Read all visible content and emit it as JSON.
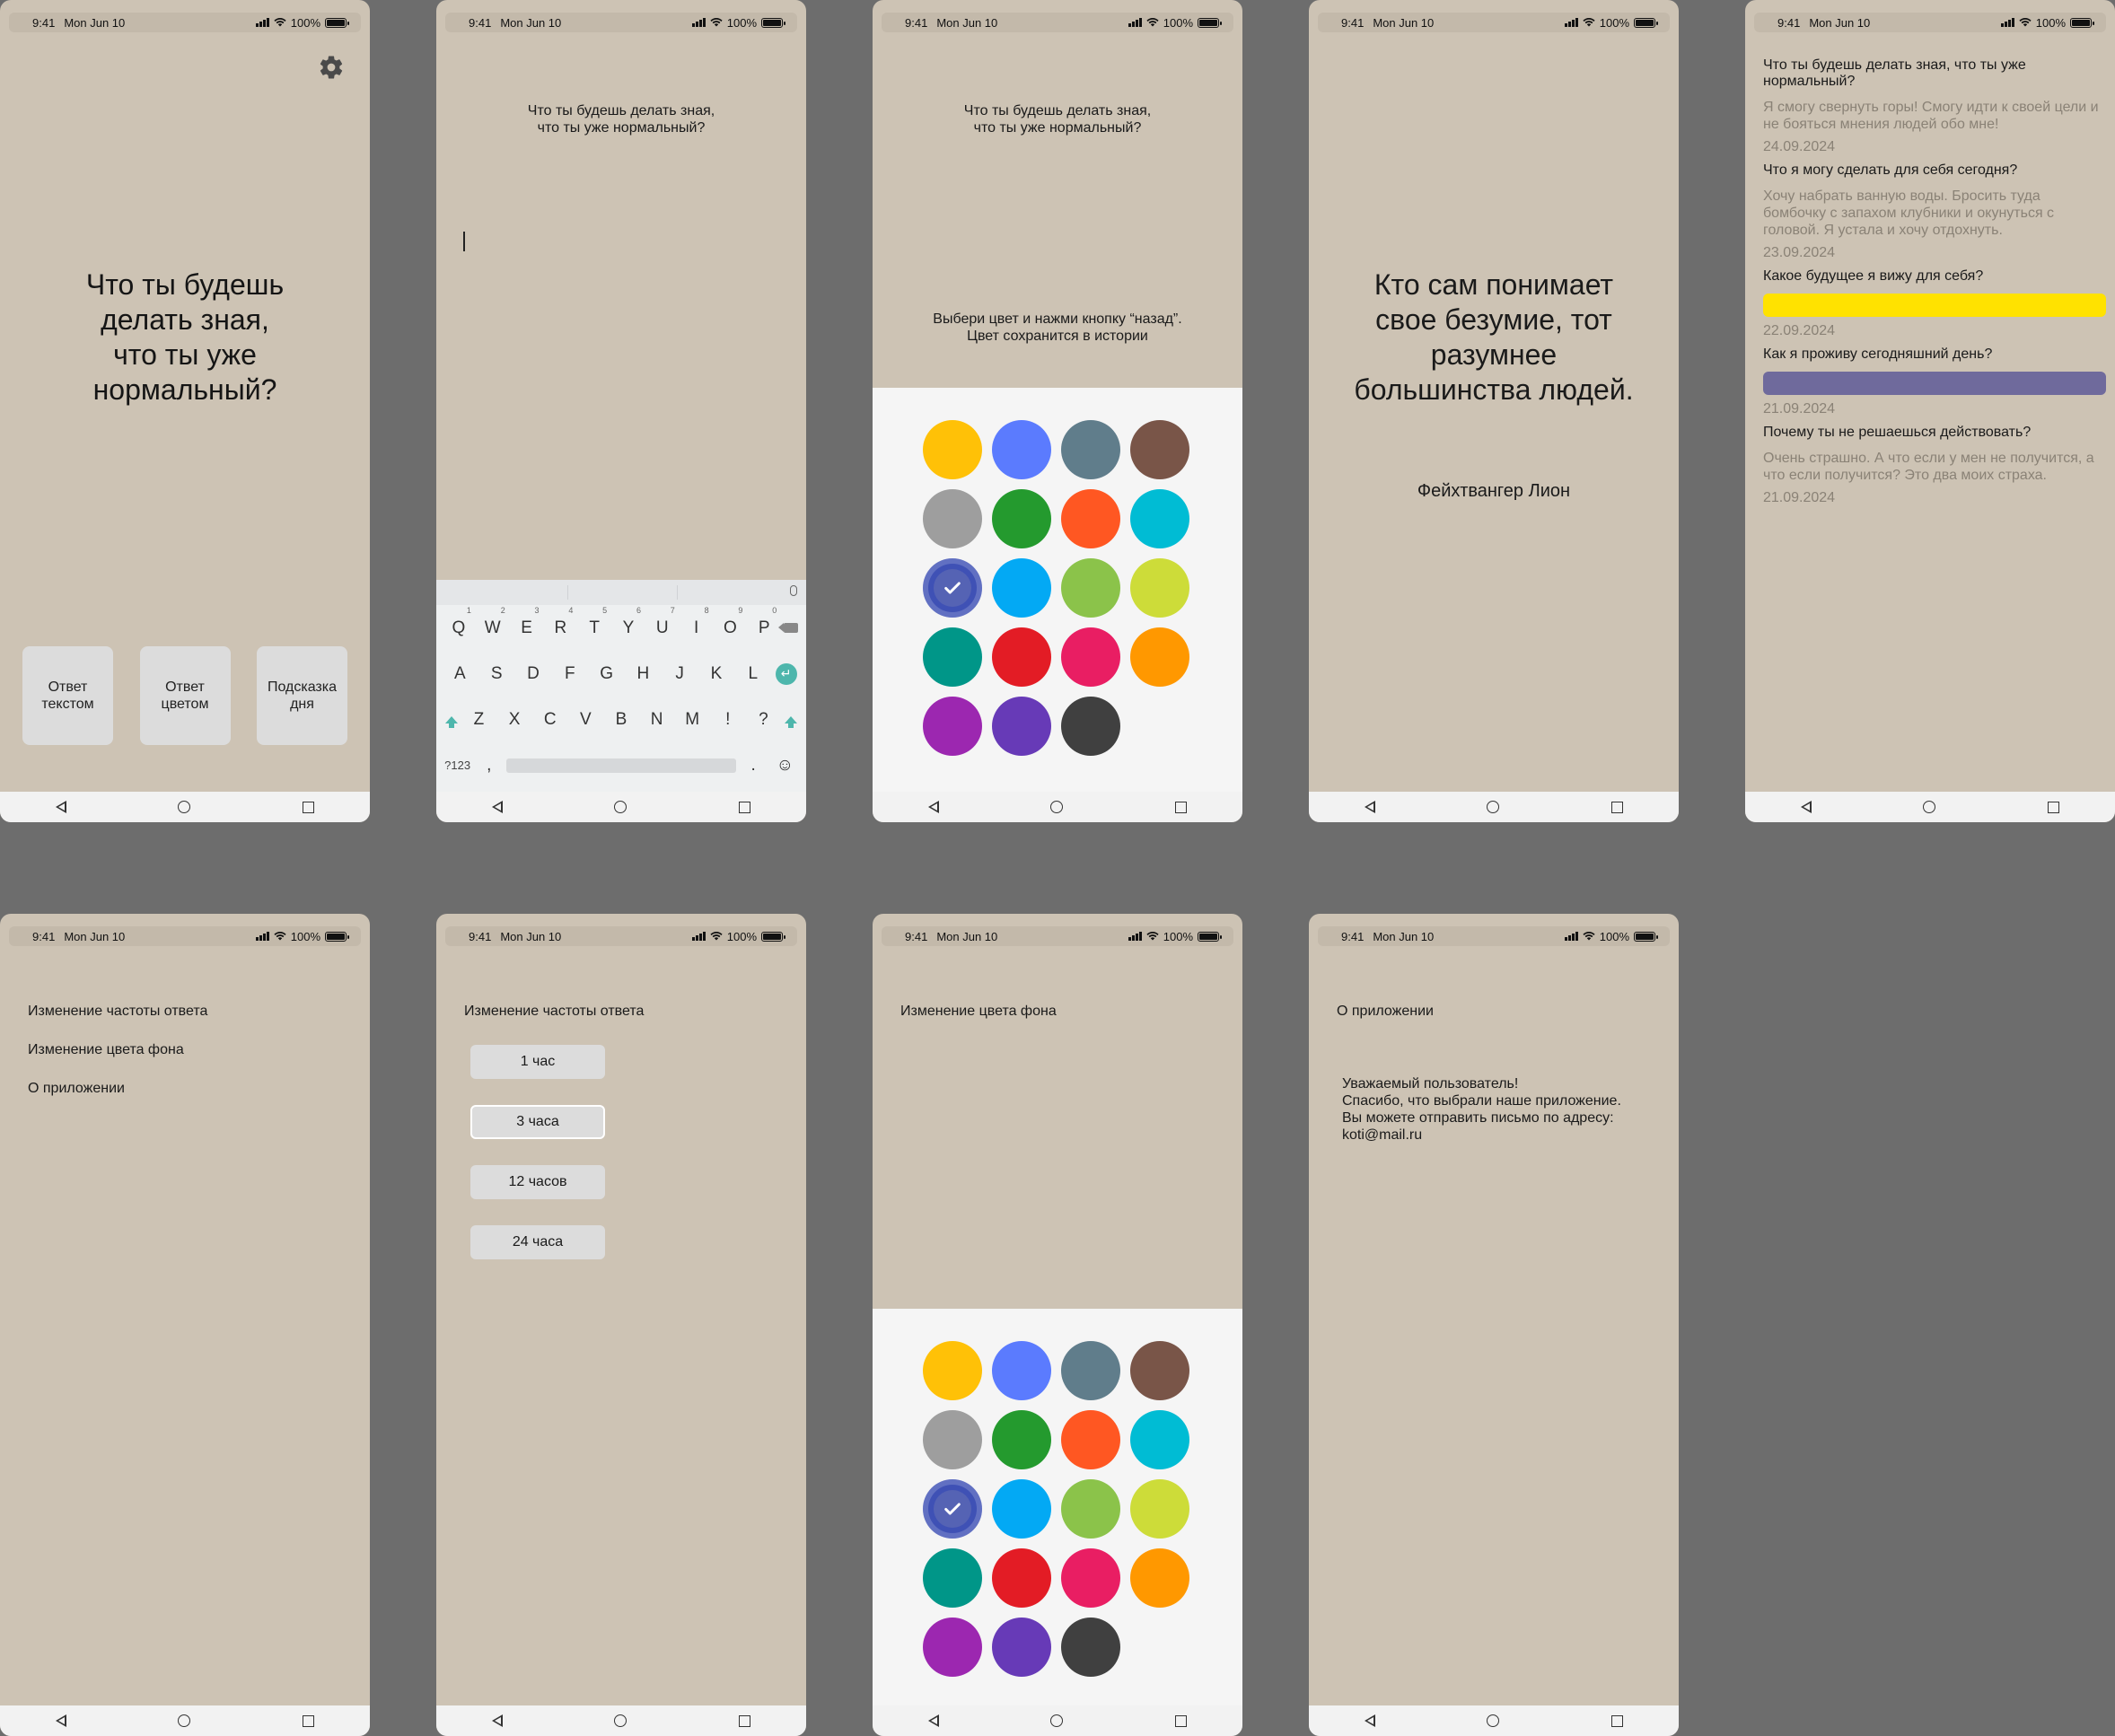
{
  "status": {
    "time": "9:41",
    "date": "Mon Jun 10",
    "battery": "100%"
  },
  "home": {
    "question": "Что ты будешь делать зная, что ты уже нормальный?",
    "question_lines": [
      "Что ты будешь",
      "делать зная,",
      "что ты уже",
      "нормальный?"
    ],
    "buttons": [
      {
        "line1": "Ответ",
        "line2": "текстом"
      },
      {
        "line1": "Ответ",
        "line2": "цветом"
      },
      {
        "line1": "Подсказка",
        "line2": "дня"
      }
    ]
  },
  "text_answer": {
    "question_lines": [
      "Что ты будешь делать зная,",
      "что ты уже нормальный?"
    ]
  },
  "keyboard": {
    "row1": [
      {
        "k": "Q",
        "n": "1"
      },
      {
        "k": "W",
        "n": "2"
      },
      {
        "k": "E",
        "n": "3"
      },
      {
        "k": "R",
        "n": "4"
      },
      {
        "k": "T",
        "n": "5"
      },
      {
        "k": "Y",
        "n": "6"
      },
      {
        "k": "U",
        "n": "7"
      },
      {
        "k": "I",
        "n": "8"
      },
      {
        "k": "O",
        "n": "9"
      },
      {
        "k": "P",
        "n": "0"
      }
    ],
    "row2": [
      "A",
      "S",
      "D",
      "F",
      "G",
      "H",
      "J",
      "K",
      "L"
    ],
    "row3": [
      "Z",
      "X",
      "C",
      "V",
      "B",
      "N",
      "M",
      "!",
      "?"
    ],
    "symbols_key": "?123",
    "comma": ",",
    "period": ".",
    "emoji": "☺"
  },
  "color_answer": {
    "question_lines": [
      "Что ты будешь делать зная,",
      "что ты уже нормальный?"
    ],
    "hint_lines": [
      "Выбери цвет и нажми кнопку “назад”.",
      "Цвет сохранится в истории"
    ]
  },
  "palette_colors": [
    "#ffc107",
    "#5b7bfe",
    "#607d8b",
    "#795548",
    "#9e9e9e",
    "#249a2e",
    "#ff5722",
    "#00bcd4",
    "#3f51b5",
    "#03a9f4",
    "#8bc34a",
    "#cddc39",
    "#009688",
    "#e31c25",
    "#e91e63",
    "#ff9800",
    "#9c27b0",
    "#673ab7",
    "#404040"
  ],
  "palette_selected_index": 8,
  "quote": {
    "lines": [
      "Кто сам понимает",
      "свое безумие, тот",
      "разумнее",
      "большинства людей."
    ],
    "author": "Фейхтвангер Лион"
  },
  "history": [
    {
      "question": "Что ты будешь делать зная, что ты уже нормальный?",
      "answer": "Я смогу свернуть горы! Смогу идти к своей цели и не бояться мнения людей обо мне!",
      "date": "24.09.2024"
    },
    {
      "question": "Что я могу сделать для себя сегодня?",
      "answer": "Хочу набрать ванную воды. Бросить туда бомбочку с запахом клубники и окунуться с головой. Я устала и хочу отдохнуть.",
      "date": "23.09.2024"
    },
    {
      "question": "Какое будущее я вижу для себя?",
      "color": "#ffe200",
      "date": "22.09.2024"
    },
    {
      "question": "Как я проживу сегодняшний день?",
      "color": "#6f6a9c",
      "date": "21.09.2024"
    },
    {
      "question": "Почему ты не решаешься действовать?",
      "answer": "Очень страшно. А что если у мен не получится, а что если получится? Это два моих страха.",
      "date": "21.09.2024"
    }
  ],
  "settings": {
    "items": [
      "Изменение частоты ответа",
      "Изменение цвета фона",
      "О приложении"
    ]
  },
  "frequency": {
    "title": "Изменение частоты ответа",
    "options": [
      "1 час",
      "3 часа",
      "12 часов",
      "24 часа"
    ],
    "selected_index": 1
  },
  "bg_color": {
    "title": "Изменение цвета фона"
  },
  "about": {
    "title": "О приложении",
    "lines": [
      "Уважаемый пользователь!",
      "Спасибо, что выбрали наше приложение.",
      "Вы можете отправить письмо по адресу:",
      "koti@mail.ru"
    ]
  }
}
